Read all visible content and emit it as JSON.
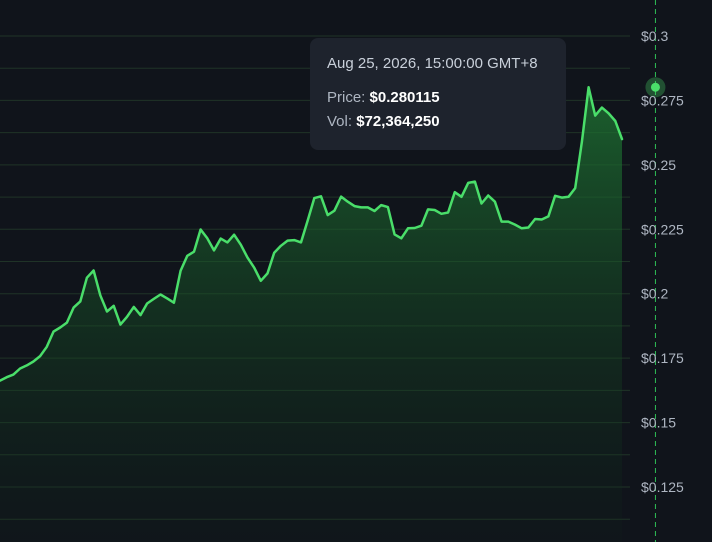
{
  "colors": {
    "background": "#10141b",
    "line": "#4ade6a",
    "area_top": "#1f7a34",
    "grid": "#1f3327",
    "crosshair": "#2fbf55",
    "tooltip_bg": "#1e232d"
  },
  "tooltip": {
    "date": "Aug 25, 2026, 15:00:00 GMT+8",
    "price_label": "Price:",
    "price_value": "$0.280115",
    "vol_label": "Vol:",
    "vol_value": "$72,364,250"
  },
  "chart_data": {
    "type": "area",
    "title": "",
    "xlabel": "",
    "ylabel": "",
    "ylim": [
      0.105,
      0.304
    ],
    "y_ticks": [
      0.125,
      0.15,
      0.175,
      0.2,
      0.225,
      0.25,
      0.275,
      0.3
    ],
    "y_tick_labels": [
      "$0.125",
      "$0.15",
      "$0.175",
      "$0.2",
      "$0.225",
      "$0.25",
      "$0.275",
      "$0.3"
    ],
    "grid": true,
    "highlight_index": 98,
    "highlight_value": 0.280115,
    "series": [
      {
        "values": [
          0.1663,
          0.1676,
          0.1686,
          0.171,
          0.1722,
          0.1737,
          0.1758,
          0.1794,
          0.1853,
          0.1869,
          0.1888,
          0.1946,
          0.197,
          0.2062,
          0.209,
          0.1994,
          0.1931,
          0.1953,
          0.188,
          0.1911,
          0.1949,
          0.1917,
          0.1962,
          0.198,
          0.1997,
          0.1982,
          0.1965,
          0.2089,
          0.2147,
          0.2163,
          0.2249,
          0.2215,
          0.2168,
          0.2214,
          0.2199,
          0.2229,
          0.219,
          0.214,
          0.2101,
          0.205,
          0.2079,
          0.2159,
          0.2186,
          0.2206,
          0.2208,
          0.2199,
          0.2284,
          0.2371,
          0.2378,
          0.2305,
          0.2322,
          0.2377,
          0.2357,
          0.234,
          0.2335,
          0.2335,
          0.2321,
          0.2344,
          0.2336,
          0.223,
          0.2215,
          0.2254,
          0.2255,
          0.2264,
          0.2327,
          0.2325,
          0.231,
          0.2315,
          0.2394,
          0.2376,
          0.243,
          0.2435,
          0.235,
          0.2381,
          0.2357,
          0.228,
          0.228,
          0.2268,
          0.2254,
          0.2257,
          0.229,
          0.2288,
          0.23,
          0.238,
          0.2373,
          0.2376,
          0.241,
          0.259,
          0.2801,
          0.2691,
          0.2722,
          0.27,
          0.267,
          0.26
        ]
      }
    ]
  }
}
